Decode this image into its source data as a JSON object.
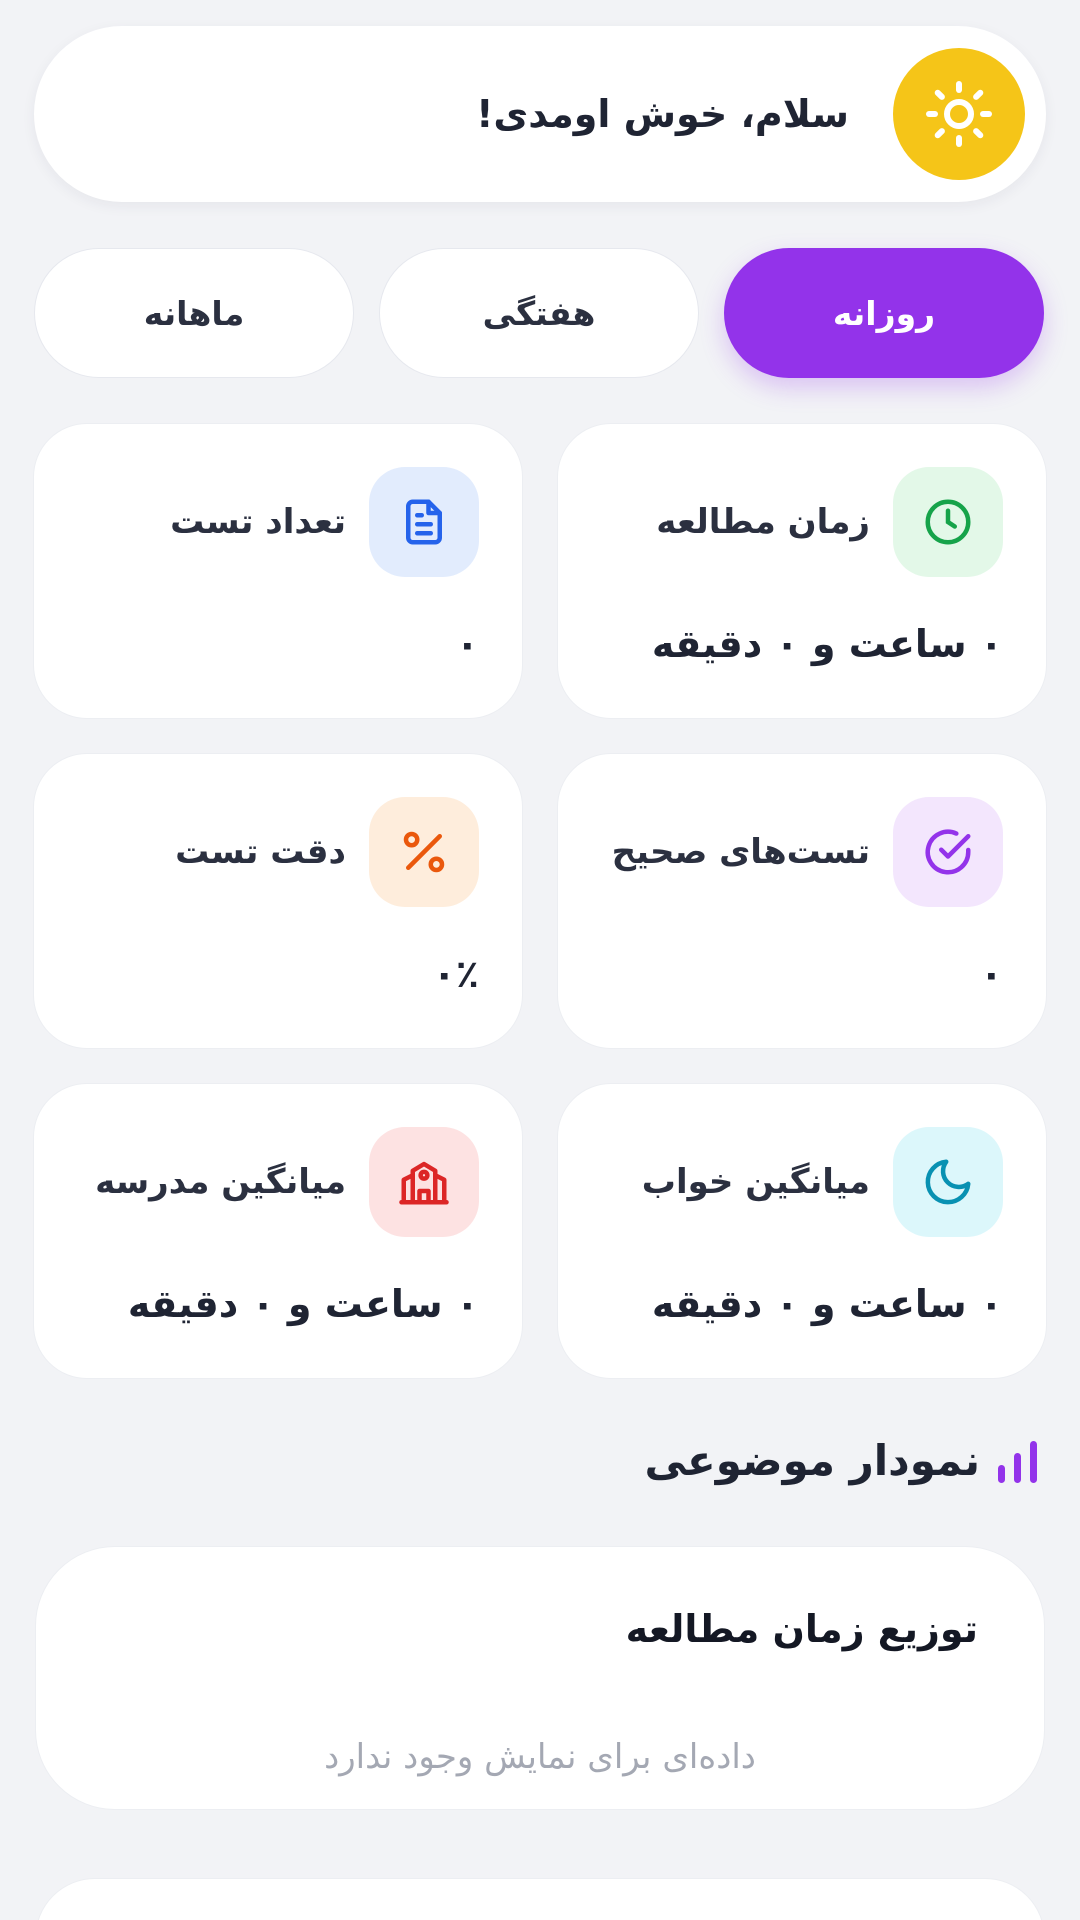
{
  "header": {
    "greeting": "سلام، خوش اومدی!",
    "icon": "sun-icon",
    "icon_bg": "#f5c518"
  },
  "tabs": [
    {
      "label": "روزانه",
      "active": true
    },
    {
      "label": "هفتگی",
      "active": false
    },
    {
      "label": "ماهانه",
      "active": false
    }
  ],
  "accent_color": "#9333ea",
  "stats": {
    "study_time": {
      "label": "زمان مطالعه",
      "value": "۰ ساعت و ۰ دقیقه",
      "icon": "clock-icon",
      "color": "#16a34a"
    },
    "test_count": {
      "label": "تعداد تست",
      "value": "۰",
      "icon": "document-icon",
      "color": "#2563eb"
    },
    "correct_tests": {
      "label": "تست‌های صحیح",
      "value": "۰",
      "icon": "check-circle-icon",
      "color": "#9333ea"
    },
    "test_accuracy": {
      "label": "دقت تست",
      "value": "۰٪",
      "icon": "percent-icon",
      "color": "#ea580c"
    },
    "sleep_avg": {
      "label": "میانگین خواب",
      "value": "۰ ساعت و ۰ دقیقه",
      "icon": "moon-icon",
      "color": "#0891b2"
    },
    "school_avg": {
      "label": "میانگین مدرسه",
      "value": "۰ ساعت و ۰ دقیقه",
      "icon": "school-icon",
      "color": "#dc2626"
    }
  },
  "section": {
    "title": "نمودار موضوعی",
    "icon": "bar-chart-icon"
  },
  "chart_card": {
    "title": "توزیع زمان مطالعه",
    "empty_text": "داده‌ای برای نمایش وجود ندارد"
  }
}
